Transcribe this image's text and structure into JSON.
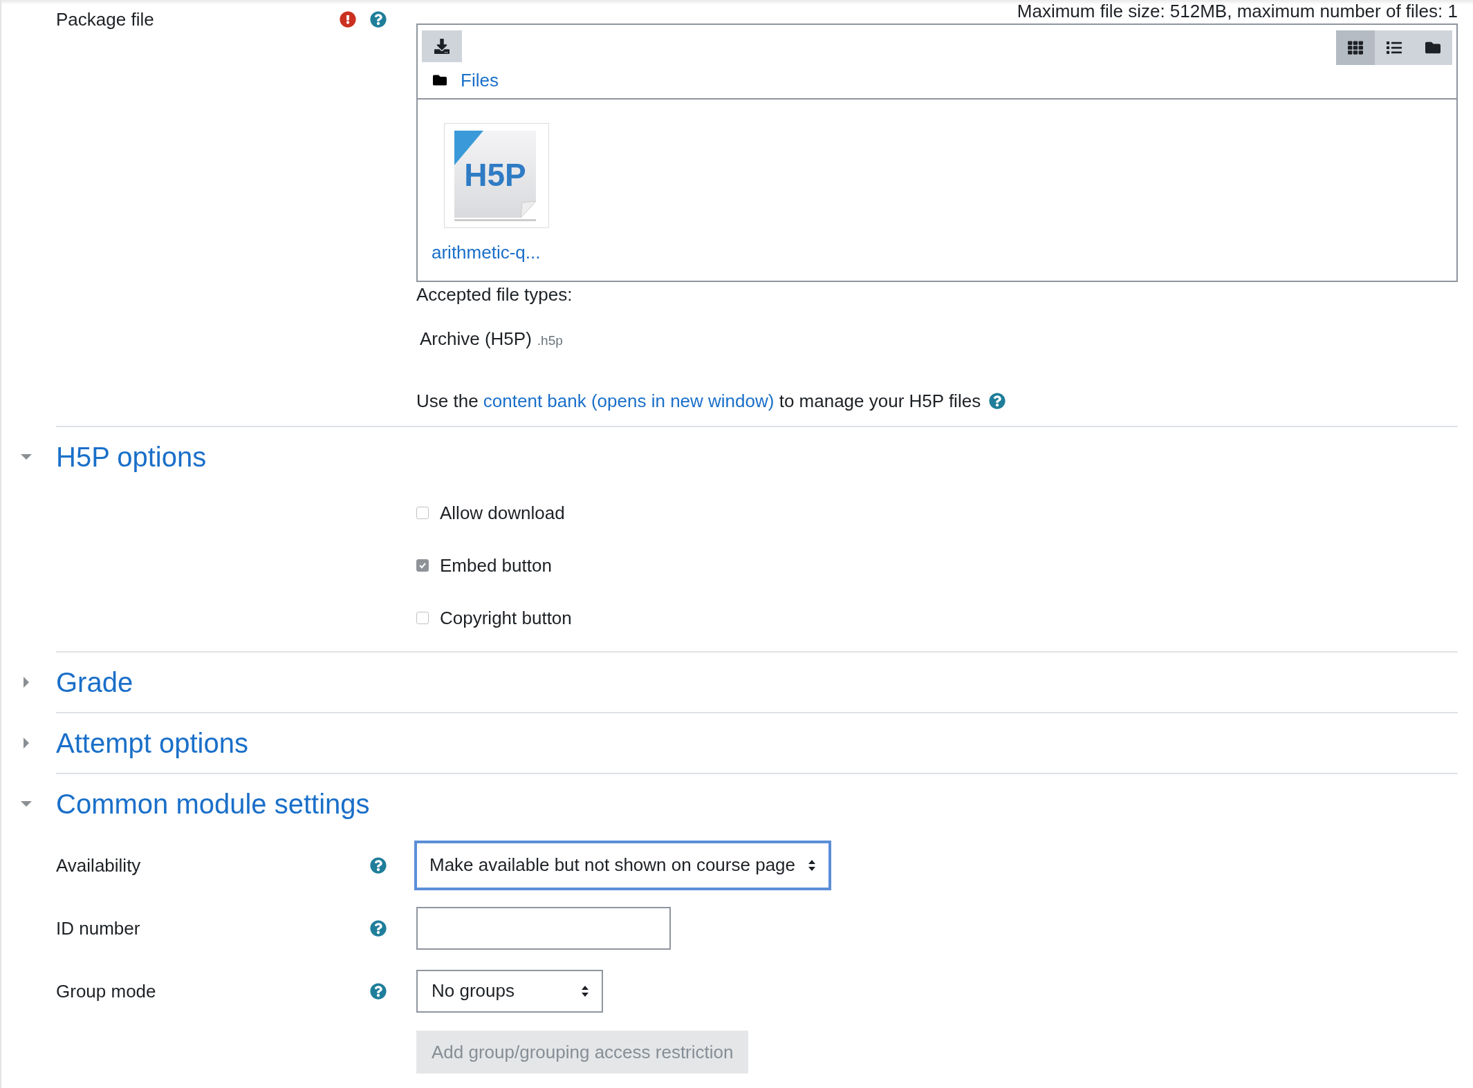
{
  "package_file": {
    "label": "Package file",
    "required": true,
    "help": true,
    "file_limits": "Maximum file size: 512MB, maximum number of files: 1",
    "picker": {
      "path": "Files",
      "views": [
        {
          "kind": "grid",
          "selected": true
        },
        {
          "kind": "list",
          "selected": false
        },
        {
          "kind": "tree",
          "selected": false
        }
      ],
      "files": [
        {
          "name": "arithmetic-q...",
          "thumbnail": "H5P"
        }
      ]
    },
    "accepted_label": "Accepted file types:",
    "accepted_types": [
      {
        "name": "Archive (H5P)",
        "ext": ".h5p"
      }
    ],
    "note": {
      "before": "Use the",
      "link": "content bank (opens in new window)",
      "after": "to manage your H5P files",
      "help": true
    }
  },
  "sections": [
    {
      "title": "H5P options",
      "expanded": true,
      "fields": [
        {
          "kind": "checkbox",
          "label": "Allow download",
          "checked": false
        },
        {
          "kind": "checkbox",
          "label": "Embed button",
          "checked": true
        },
        {
          "kind": "checkbox",
          "label": "Copyright button",
          "checked": false
        }
      ]
    },
    {
      "title": "Grade",
      "expanded": false
    },
    {
      "title": "Attempt options",
      "expanded": false
    },
    {
      "title": "Common module settings",
      "expanded": true,
      "fields": [
        {
          "kind": "select",
          "label": "Availability",
          "value": "Make available but not shown on course page",
          "help": true,
          "focused": true
        },
        {
          "kind": "text",
          "label": "ID number",
          "help": true
        },
        {
          "kind": "select",
          "label": "Group mode",
          "value": "No groups",
          "help": true,
          "focused": false
        },
        {
          "kind": "button",
          "label": "Add group/grouping access restriction",
          "disabled": true
        }
      ]
    }
  ]
}
